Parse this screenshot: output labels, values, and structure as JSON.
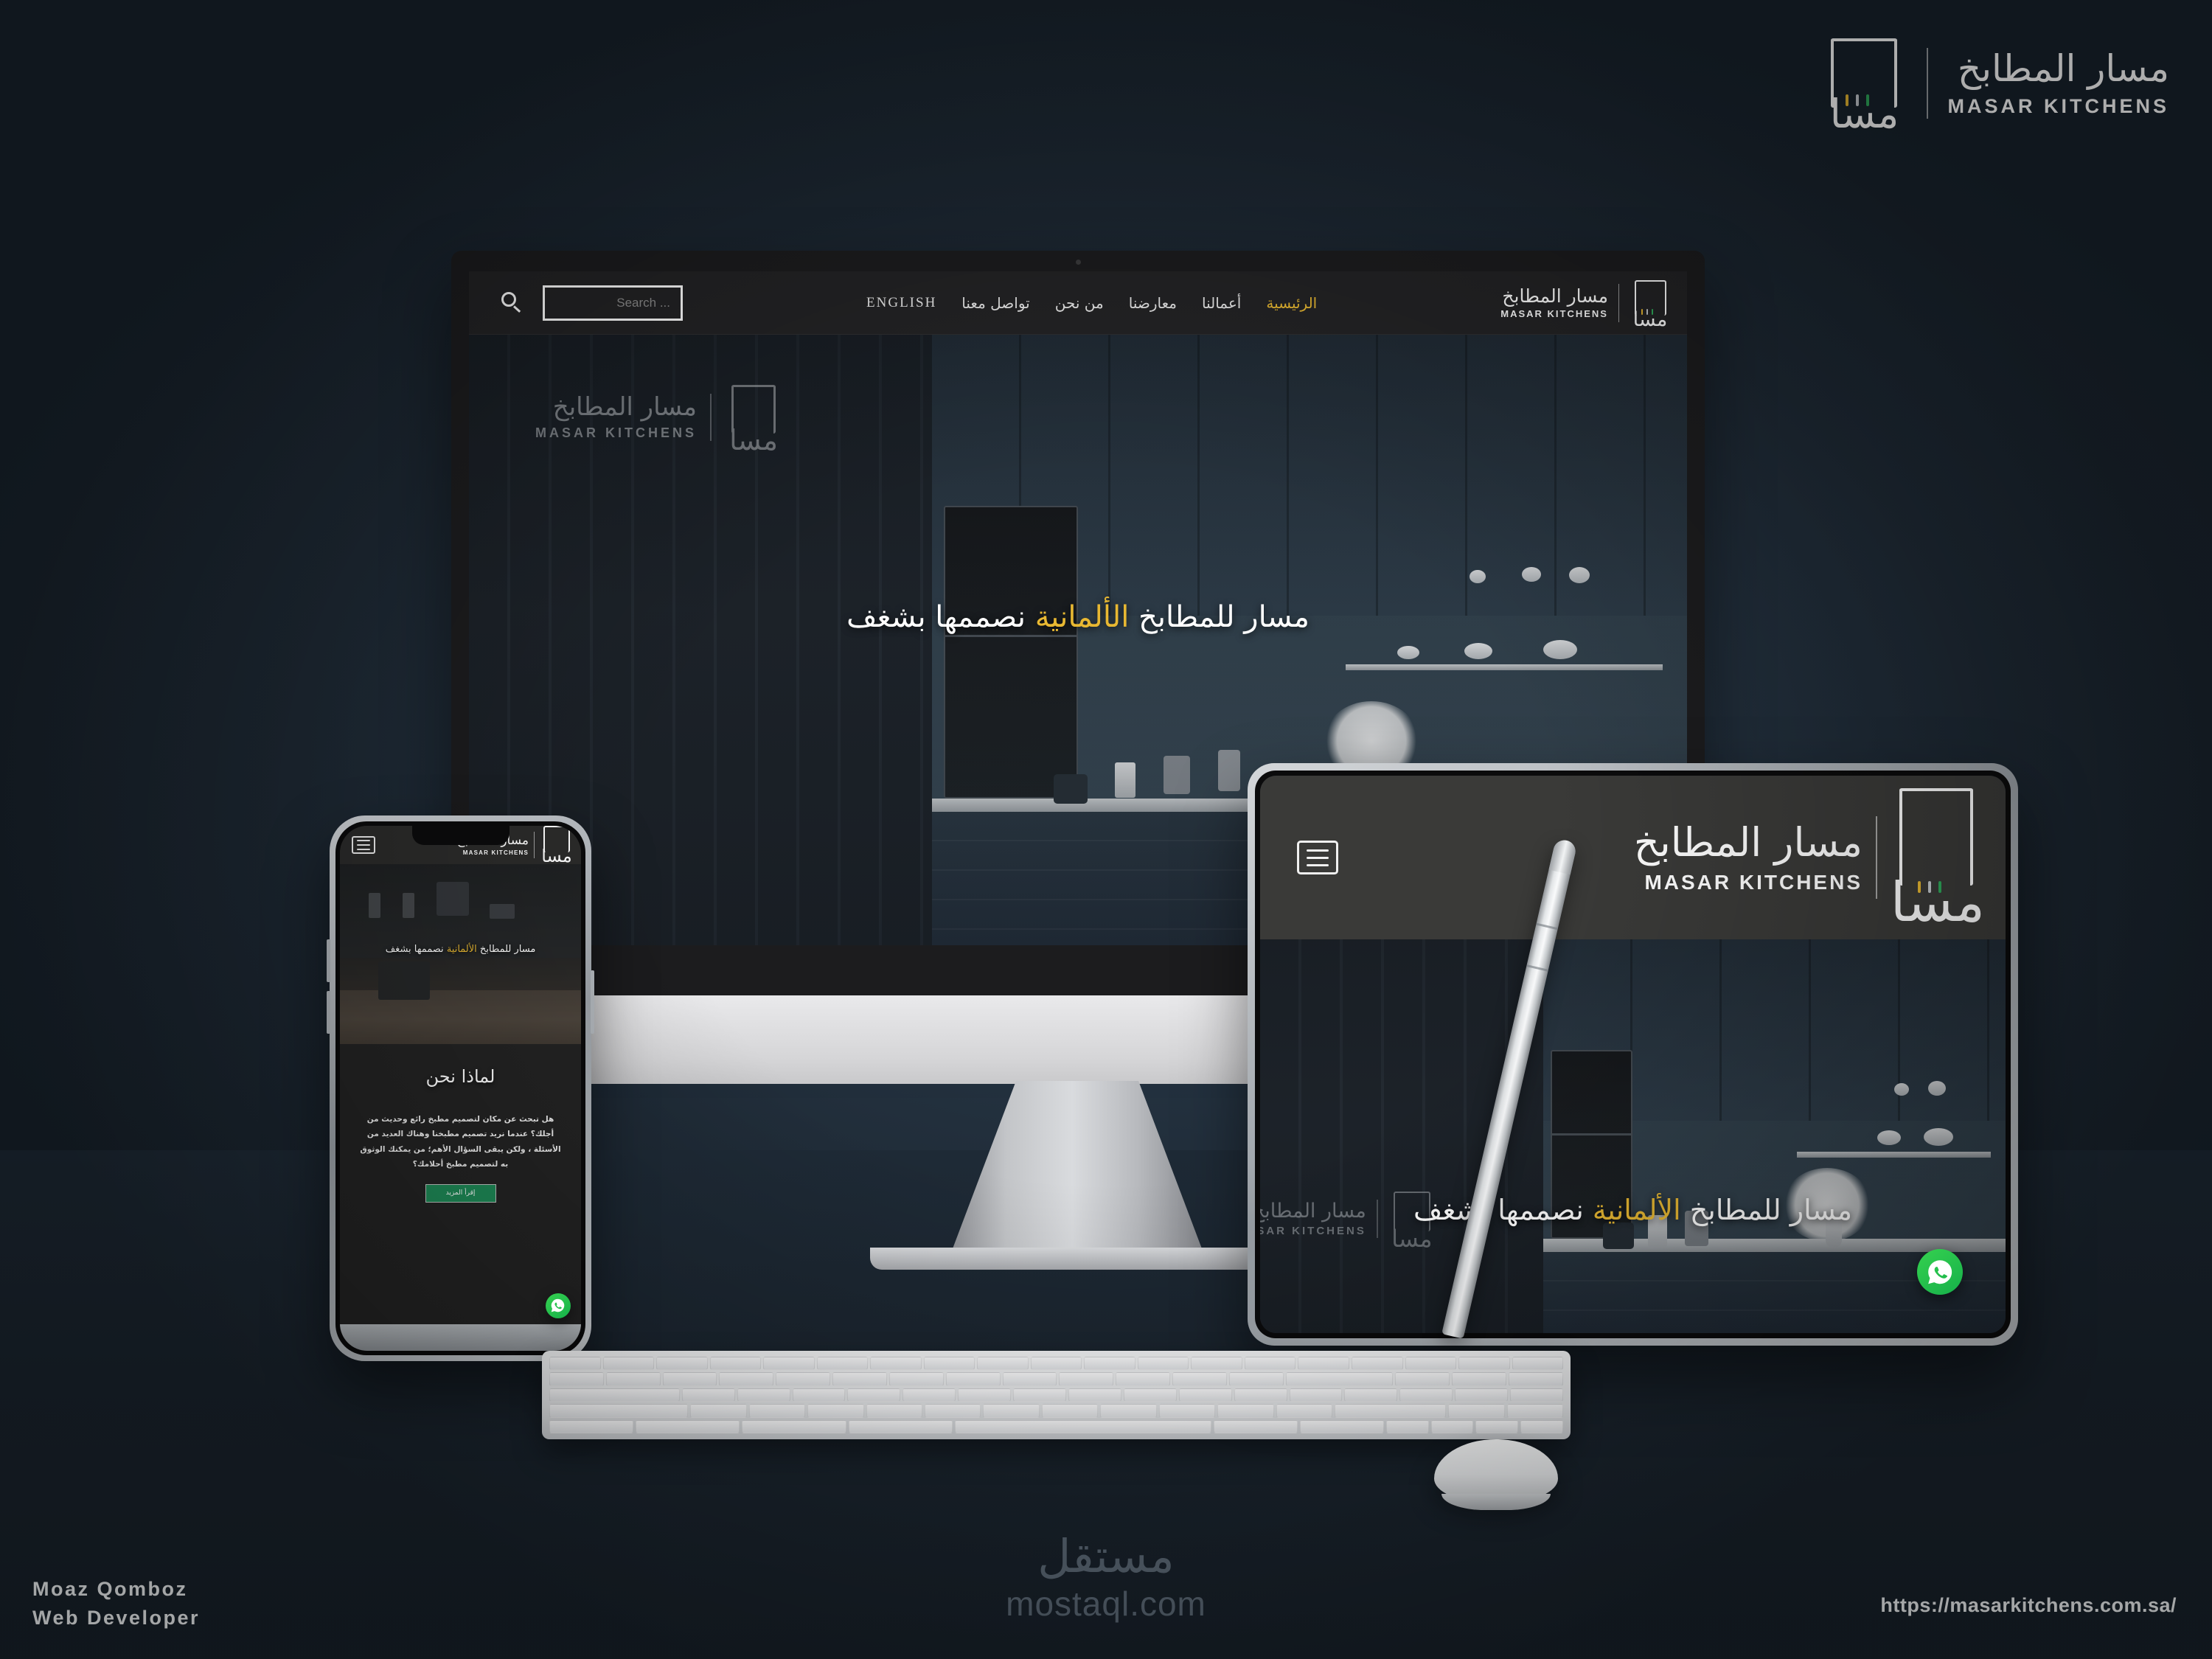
{
  "brand": {
    "arabic": "مسار المطابخ",
    "english": "MASAR KITCHENS",
    "mark_glyph": "مسا",
    "accent_gold": "#e8b832",
    "accent_green": "#1e8a57"
  },
  "desktop": {
    "nav": {
      "search_placeholder": "Search ...",
      "links": [
        {
          "label": "الرئيسية",
          "active": true
        },
        {
          "label": "أعمالنا",
          "active": false
        },
        {
          "label": "معارضنا",
          "active": false
        },
        {
          "label": "من نحن",
          "active": false
        },
        {
          "label": "تواصل معنا",
          "active": false
        },
        {
          "label": "ENGLISH",
          "active": false
        }
      ]
    },
    "hero": {
      "headline_before": "مسار للمطابخ ",
      "headline_highlight": "الألمانية",
      "headline_after": " نصممها بشغف"
    }
  },
  "tablet": {
    "hero": {
      "headline_before": "مسار للمطابخ ",
      "headline_highlight": "الألمانية",
      "headline_after": " نصممها بشغف"
    }
  },
  "phone": {
    "hero": {
      "headline_before": "مسار للمطابخ ",
      "headline_highlight": "الألمانية",
      "headline_after": " نصممها بشغف"
    },
    "about": {
      "heading": "لماذا نحن",
      "body": "هل تبحث عن مكان لتصميم مطبخ رائع وحديث من أجلك؟ عندما نريد تصميم مطبخنا وهناك العديد من الأسئلة ، ولكن يبقى السؤال الأهم؛ من يمكنك الوثوق به لتصميم مطبخ أحلامك؟",
      "cta_label": "إقرأ المزيد"
    }
  },
  "footer": {
    "mostaql_arabic": "مستقل",
    "mostaql_domain": "mostaql.com",
    "credit_name": "Moaz Qomboz",
    "credit_role": "Web Developer",
    "site_url": "https://masarkitchens.com.sa/"
  }
}
